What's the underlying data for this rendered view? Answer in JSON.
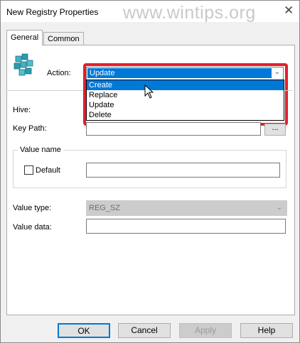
{
  "window": {
    "title": "New Registry Properties",
    "watermark": "www.wintips.org",
    "close_symbol": "✕"
  },
  "tabs": [
    {
      "label": "General",
      "active": true
    },
    {
      "label": "Common",
      "active": false
    }
  ],
  "icons": {
    "registry": "registry-cubes-icon",
    "cursor": "mouse-pointer-icon"
  },
  "action": {
    "label": "Action:",
    "selected": "Update",
    "options": [
      "Create",
      "Replace",
      "Update",
      "Delete"
    ],
    "highlighted": "Create"
  },
  "hive": {
    "label": "Hive:"
  },
  "key_path": {
    "label": "Key Path:",
    "value": "",
    "browse_label": "..."
  },
  "value_name": {
    "group_label": "Value name",
    "default_label": "Default",
    "default_checked": false,
    "value": ""
  },
  "value_type": {
    "label": "Value type:",
    "value": "REG_SZ"
  },
  "value_data": {
    "label": "Value data:",
    "value": ""
  },
  "buttons": {
    "ok": "OK",
    "cancel": "Cancel",
    "apply": "Apply",
    "help": "Help"
  },
  "colors": {
    "accent": "#0078d7",
    "highlight_box": "#e2202b"
  }
}
